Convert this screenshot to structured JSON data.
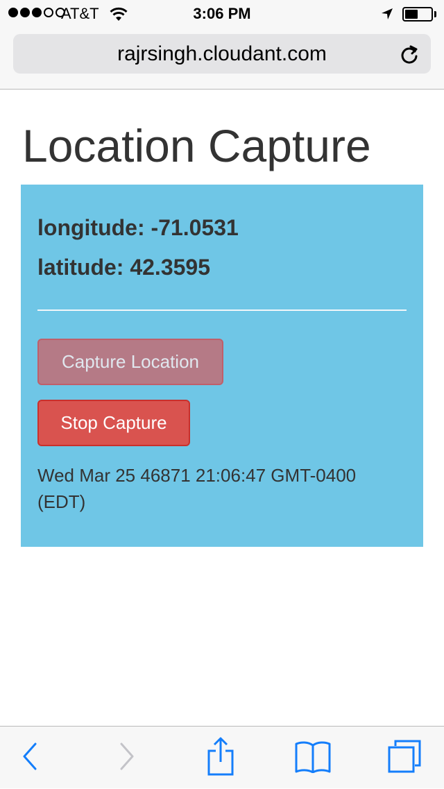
{
  "status_bar": {
    "carrier": "AT&T",
    "time": "3:06 PM",
    "signal_bars_filled": 3,
    "signal_bars_total": 5,
    "battery_level": 0.5
  },
  "browser": {
    "url": "rajrsingh.cloudant.com",
    "icons": {
      "reload": "reload-icon",
      "back": "chevron-left-icon",
      "forward": "chevron-right-icon",
      "share": "share-icon",
      "bookmarks": "book-icon",
      "tabs": "tabs-icon"
    },
    "accent_color": "#147efb"
  },
  "page": {
    "title": "Location Capture",
    "panel_color": "#6fc6e6",
    "longitude_text": "longitude: -71.0531",
    "latitude_text": "latitude: 42.3595",
    "capture_button_label": "Capture Location",
    "stop_button_label": "Stop Capture",
    "timestamp": "Wed Mar 25 46871 21:06:47 GMT-0400 (EDT)",
    "stop_button_color": "#d9534f"
  }
}
